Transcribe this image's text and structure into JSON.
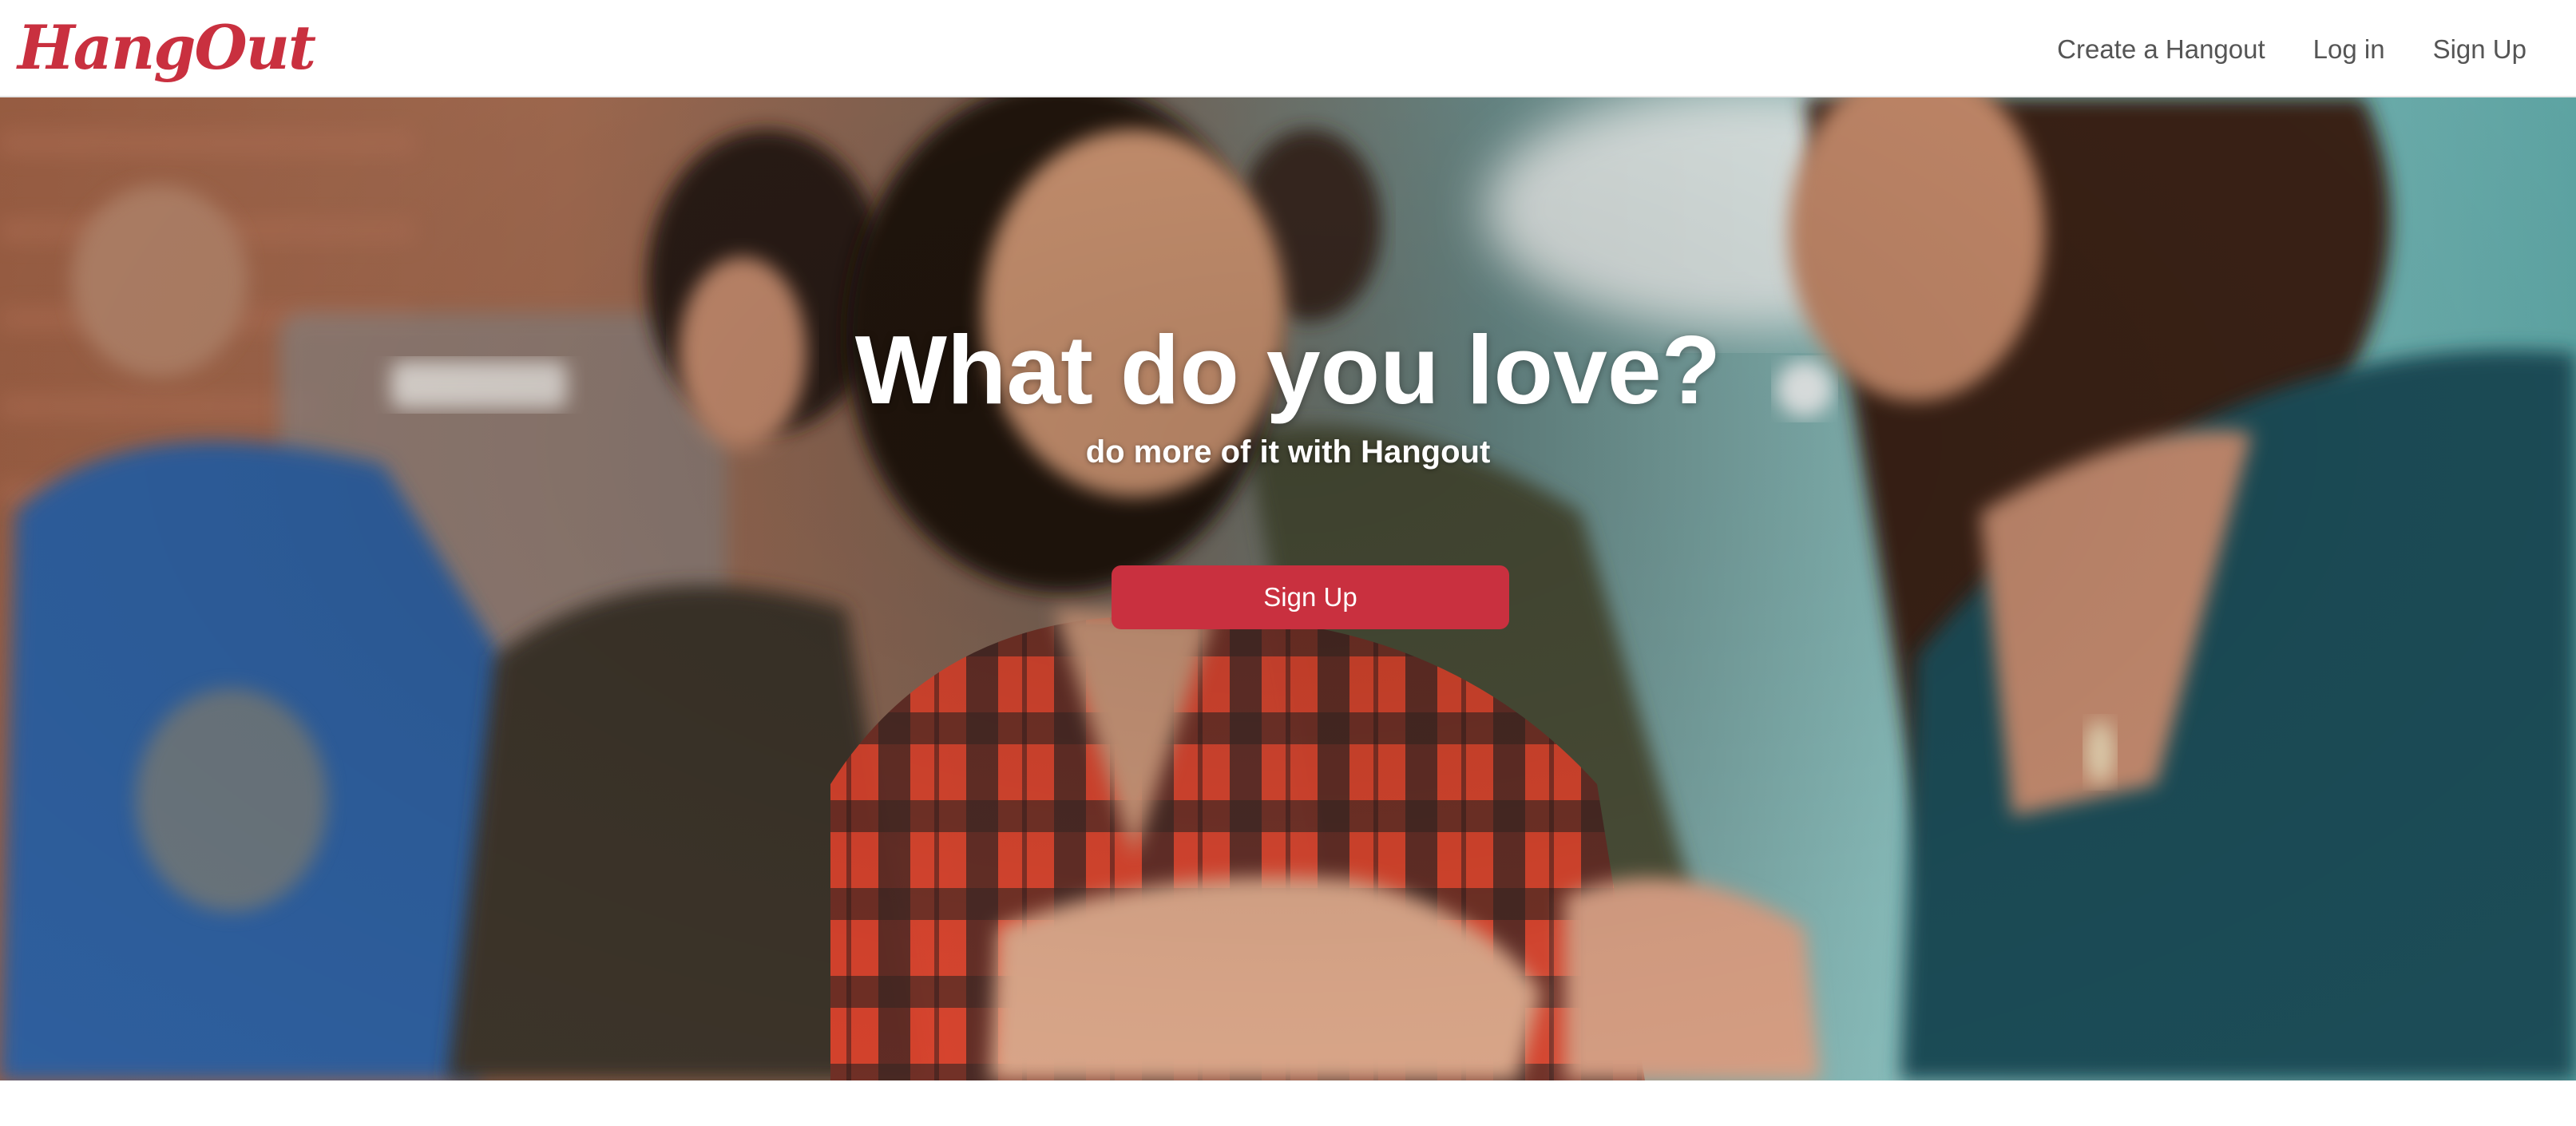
{
  "brand": {
    "logo_text": "HangOut",
    "accent_color": "#c9303f"
  },
  "nav": {
    "links": [
      {
        "label": "Create a Hangout"
      },
      {
        "label": "Log in"
      },
      {
        "label": "Sign Up"
      }
    ]
  },
  "hero": {
    "title": "What do you love?",
    "subtitle": "do more of it with Hangout",
    "cta_label": "Sign Up",
    "image": "photo-of-people-talking"
  }
}
